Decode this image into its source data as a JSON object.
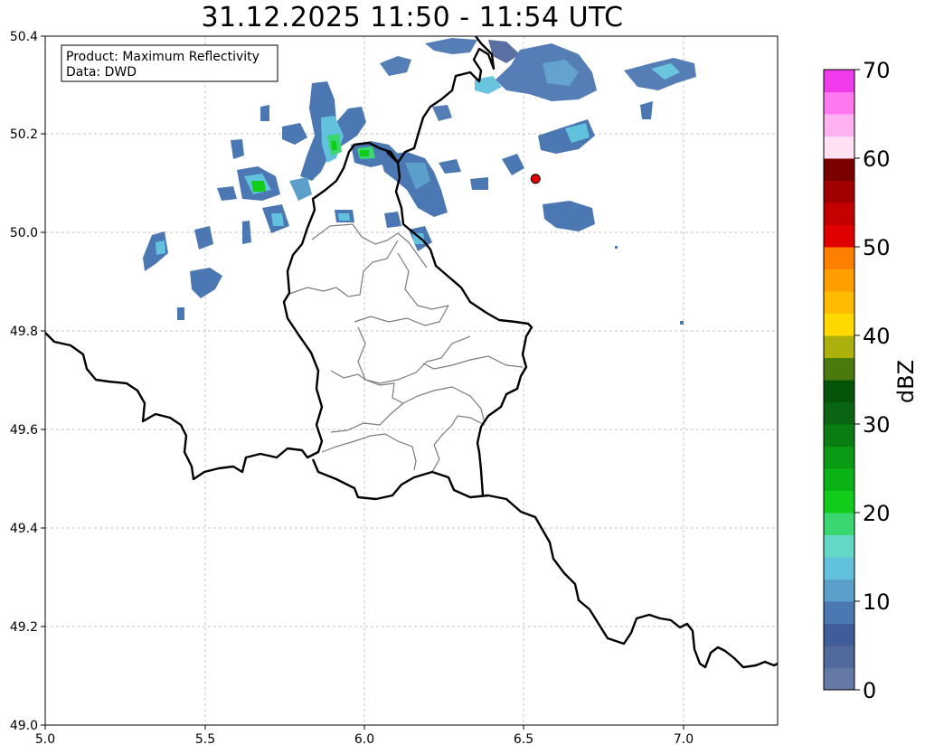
{
  "title": "31.12.2025 11:50 - 11:54 UTC",
  "info_box": {
    "product": "Product: Maximum Reflectivity",
    "data": "Data: DWD"
  },
  "axes": {
    "xlim": [
      5.0,
      7.3
    ],
    "ylim": [
      49.0,
      50.4
    ],
    "x_ticks": [
      "5.0",
      "5.5",
      "6.0",
      "6.5",
      "7.0"
    ],
    "y_ticks": [
      "49.0",
      "49.2",
      "49.4",
      "49.6",
      "49.8",
      "50.0",
      "50.2",
      "50.4"
    ],
    "grid": true
  },
  "marker": {
    "lon": 6.54,
    "lat": 50.11,
    "color": "#e00000"
  },
  "colorbar": {
    "label": "dBZ",
    "min": 0,
    "max": 70,
    "tick_labels": [
      "0",
      "10",
      "20",
      "30",
      "40",
      "50",
      "60",
      "70"
    ],
    "colors": [
      "#6479a6",
      "#52699e",
      "#415c9b",
      "#4b78b2",
      "#5b9fcb",
      "#62c1dc",
      "#63d8c6",
      "#3ad66f",
      "#12cc1a",
      "#0cb316",
      "#0a9a13",
      "#097c12",
      "#0a6512",
      "#065408",
      "#4a7a0d",
      "#acb00c",
      "#ffd800",
      "#ffbb00",
      "#ff9e00",
      "#ff7f00",
      "#e10000",
      "#c50000",
      "#a10000",
      "#7a0000",
      "#ffe0f5",
      "#ffb1f2",
      "#ff78f1",
      "#f03ced"
    ]
  }
}
